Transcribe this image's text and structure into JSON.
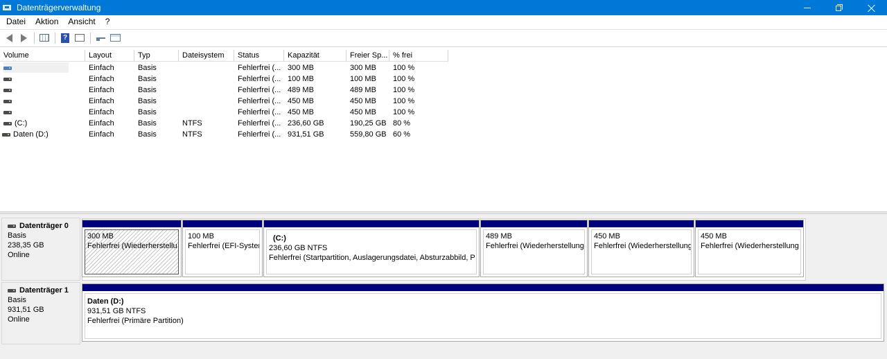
{
  "window": {
    "title": "Datenträgerverwaltung"
  },
  "menu": [
    "Datei",
    "Aktion",
    "Ansicht",
    "?"
  ],
  "toolbar": {
    "icons": [
      "back-arrow-icon",
      "forward-arrow-icon",
      "console-tree-icon",
      "help-icon",
      "properties-icon",
      "rescan-icon",
      "window-icon"
    ]
  },
  "volume_list": {
    "columns": [
      "Volume",
      "Layout",
      "Typ",
      "Dateisystem",
      "Status",
      "Kapazität",
      "Freier Sp...",
      "% frei"
    ],
    "rows": [
      {
        "volume": "",
        "layout": "Einfach",
        "typ": "Basis",
        "fs": "",
        "status": "Fehlerfrei (...",
        "capacity": "300 MB",
        "free": "300 MB",
        "pct": "100 %"
      },
      {
        "volume": "",
        "layout": "Einfach",
        "typ": "Basis",
        "fs": "",
        "status": "Fehlerfrei (...",
        "capacity": "100 MB",
        "free": "100 MB",
        "pct": "100 %"
      },
      {
        "volume": "",
        "layout": "Einfach",
        "typ": "Basis",
        "fs": "",
        "status": "Fehlerfrei (...",
        "capacity": "489 MB",
        "free": "489 MB",
        "pct": "100 %"
      },
      {
        "volume": "",
        "layout": "Einfach",
        "typ": "Basis",
        "fs": "",
        "status": "Fehlerfrei (...",
        "capacity": "450 MB",
        "free": "450 MB",
        "pct": "100 %"
      },
      {
        "volume": "",
        "layout": "Einfach",
        "typ": "Basis",
        "fs": "",
        "status": "Fehlerfrei (...",
        "capacity": "450 MB",
        "free": "450 MB",
        "pct": "100 %"
      },
      {
        "volume": "(C:)",
        "layout": "Einfach",
        "typ": "Basis",
        "fs": "NTFS",
        "status": "Fehlerfrei (...",
        "capacity": "236,60 GB",
        "free": "190,25 GB",
        "pct": "80 %"
      },
      {
        "volume": "Daten (D:)",
        "layout": "Einfach",
        "typ": "Basis",
        "fs": "NTFS",
        "status": "Fehlerfrei (...",
        "capacity": "931,51 GB",
        "free": "559,80 GB",
        "pct": "60 %"
      }
    ]
  },
  "disks": [
    {
      "name": "Datenträger 0",
      "type": "Basis",
      "size": "238,35 GB",
      "state": "Online",
      "partitions": [
        {
          "name": "",
          "size": "300 MB",
          "status": "Fehlerfrei (Wiederherstellu"
        },
        {
          "name": "",
          "size": "100 MB",
          "status": "Fehlerfrei (EFI-Systen"
        },
        {
          "name": "(C:)",
          "size": "236,60 GB NTFS",
          "status": "Fehlerfrei (Startpartition, Auslagerungsdatei, Absturzabbild, P"
        },
        {
          "name": "",
          "size": "489 MB",
          "status": "Fehlerfrei (Wiederherstellung"
        },
        {
          "name": "",
          "size": "450 MB",
          "status": "Fehlerfrei (Wiederherstellung"
        },
        {
          "name": "",
          "size": "450 MB",
          "status": "Fehlerfrei (Wiederherstellung"
        }
      ]
    },
    {
      "name": "Datenträger 1",
      "type": "Basis",
      "size": "931,51 GB",
      "state": "Online",
      "partitions": [
        {
          "name": "Daten  (D:)",
          "size": "931,51 GB NTFS",
          "status": "Fehlerfrei (Primäre Partition)"
        }
      ]
    }
  ],
  "colors": {
    "title_bar": "#0078d7",
    "partition_header": "#00007f"
  }
}
